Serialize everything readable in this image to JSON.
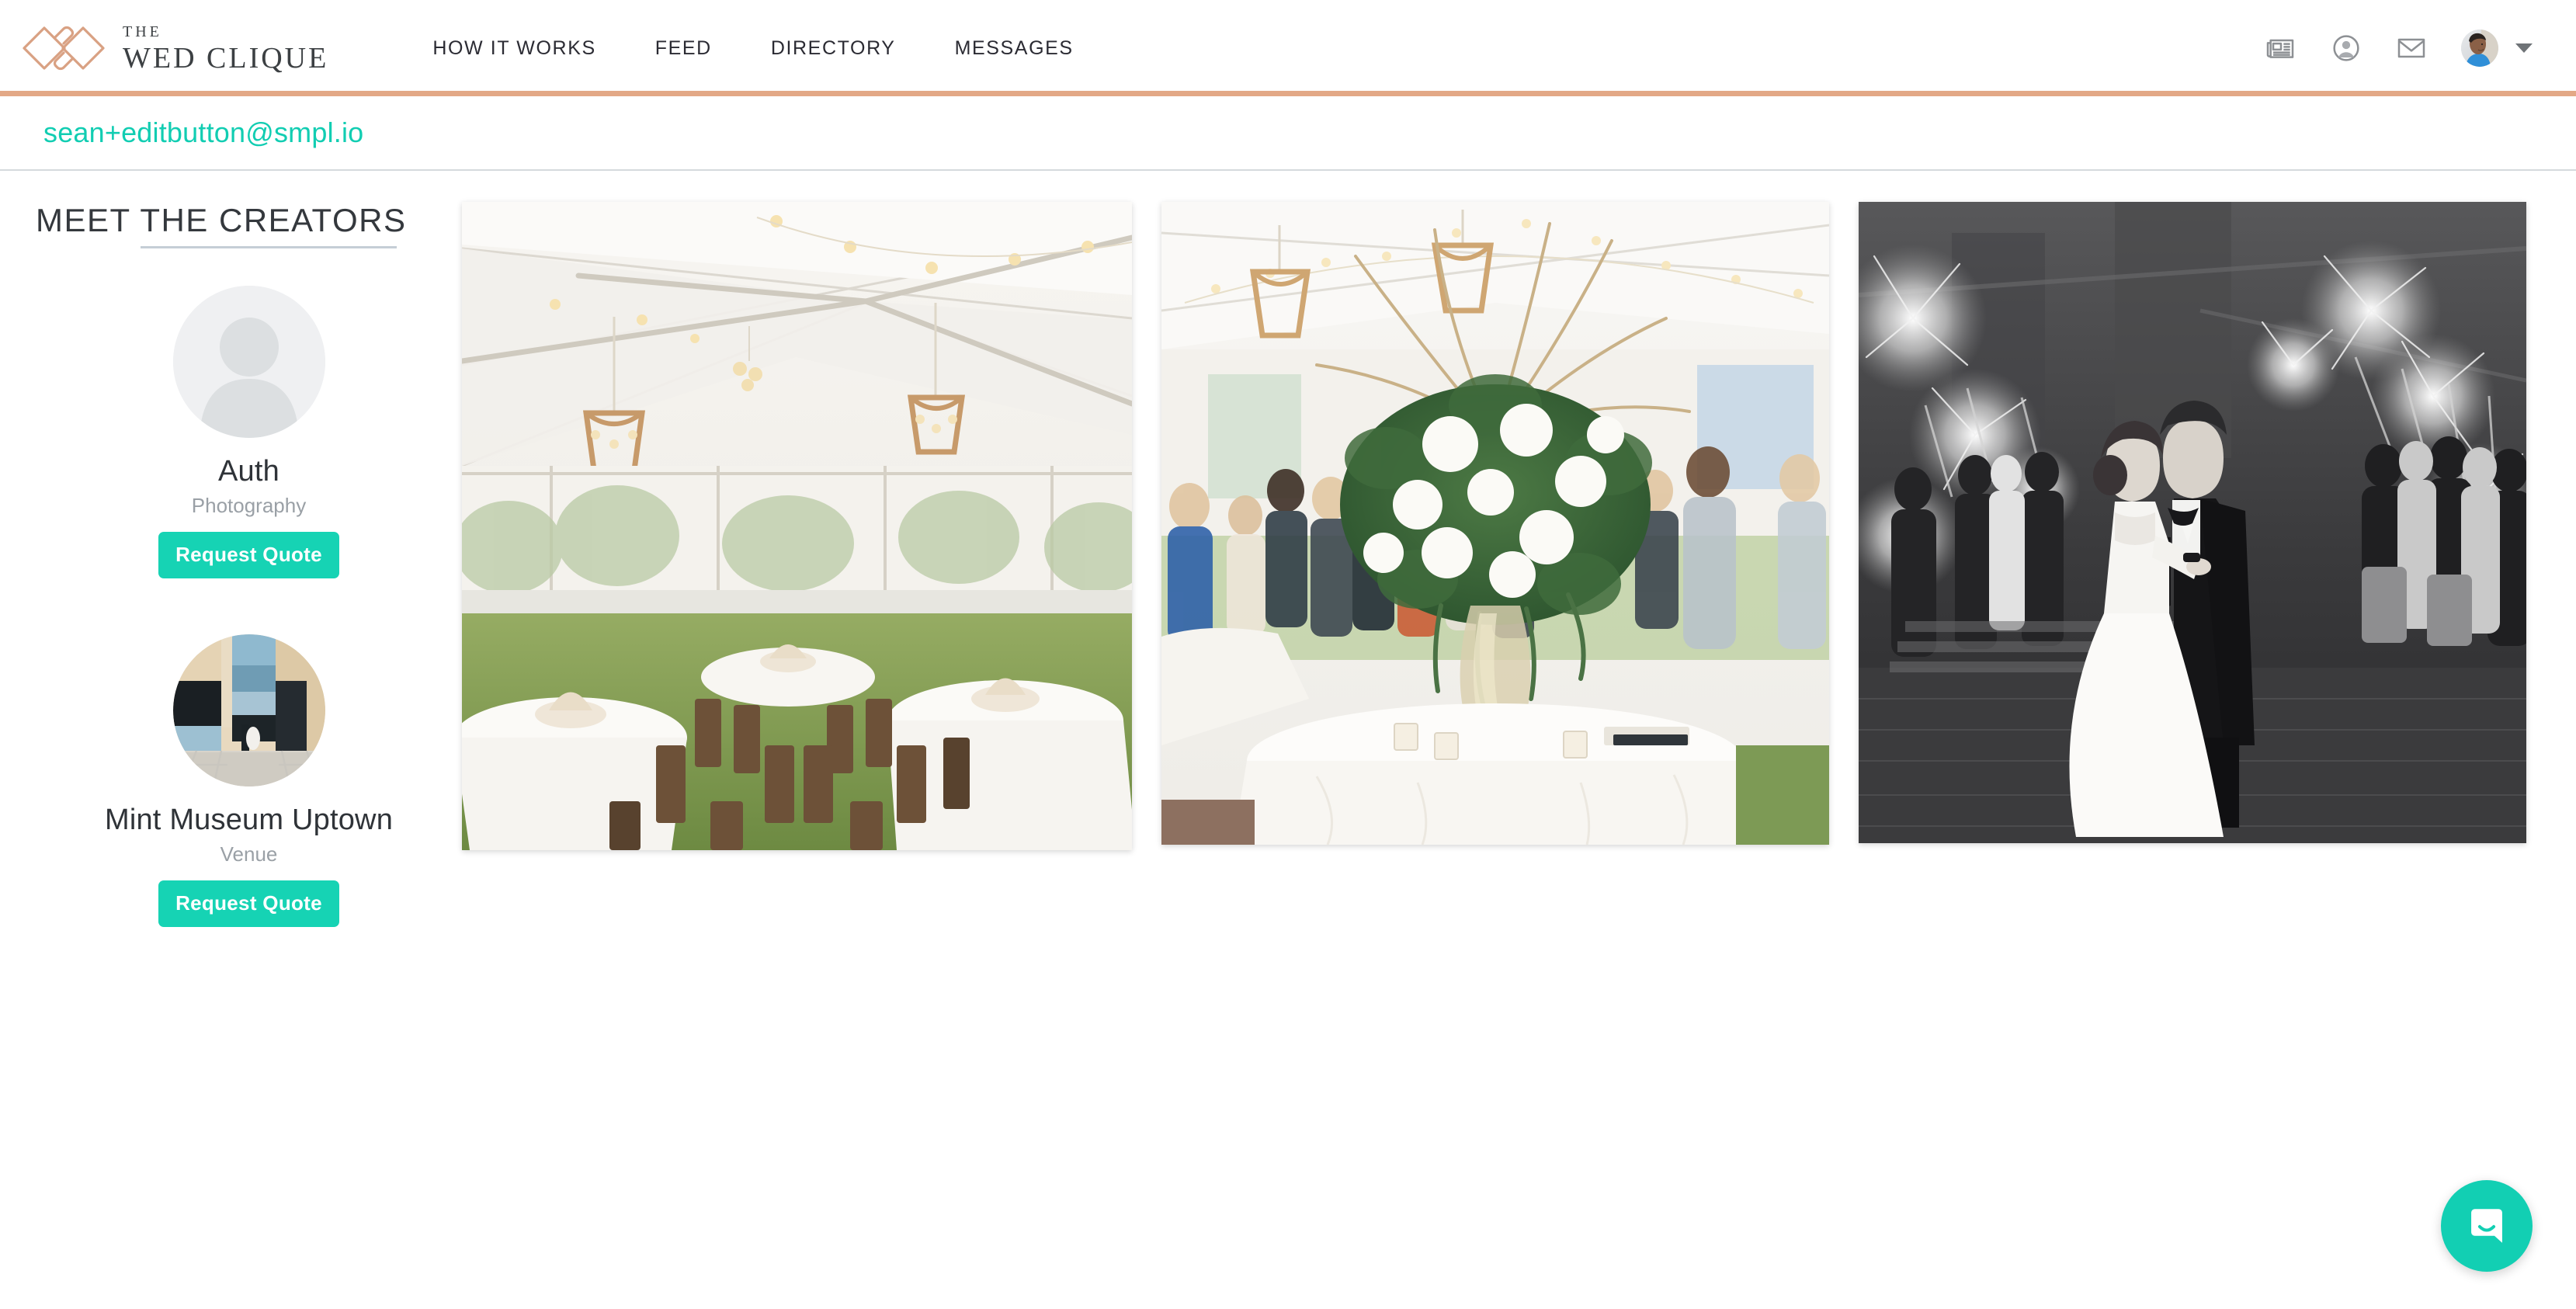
{
  "header": {
    "logo": {
      "icon": "interlocking-diamonds-logo",
      "the": "THE",
      "name": "WED CLIQUE",
      "color": "#d9a183"
    },
    "nav": [
      {
        "label": "HOW IT WORKS"
      },
      {
        "label": "FEED"
      },
      {
        "label": "DIRECTORY"
      },
      {
        "label": "MESSAGES"
      }
    ],
    "icons": [
      {
        "name": "newspaper-icon"
      },
      {
        "name": "user-circle-icon"
      },
      {
        "name": "envelope-icon"
      }
    ],
    "avatar": {
      "name": "user-avatar",
      "caret": "chevron-down-icon"
    },
    "accent_color": "#e3a886"
  },
  "subbar": {
    "email": "sean+editbutton@smpl.io",
    "email_color": "#11cdb2"
  },
  "sidebar": {
    "title": "MEET THE CREATORS",
    "creators": [
      {
        "name": "Auth",
        "role": "Photography",
        "button_label": "Request Quote",
        "avatar_type": "placeholder-person"
      },
      {
        "name": "Mint Museum Uptown",
        "role": "Venue",
        "button_label": "Request Quote",
        "avatar_type": "venue-photo"
      }
    ],
    "button_color": "#16d3b4"
  },
  "gallery": {
    "images": [
      {
        "alt": "White tent reception with chandeliers and string lights over farm tables"
      },
      {
        "alt": "Tall white and green floral centerpiece on round white linen table"
      },
      {
        "alt": "Black and white sparkler exit of bride and groom kissing"
      }
    ]
  },
  "chat": {
    "label": "Open chat",
    "icon": "speech-bubble-smile-icon",
    "color": "#12cfb3"
  }
}
